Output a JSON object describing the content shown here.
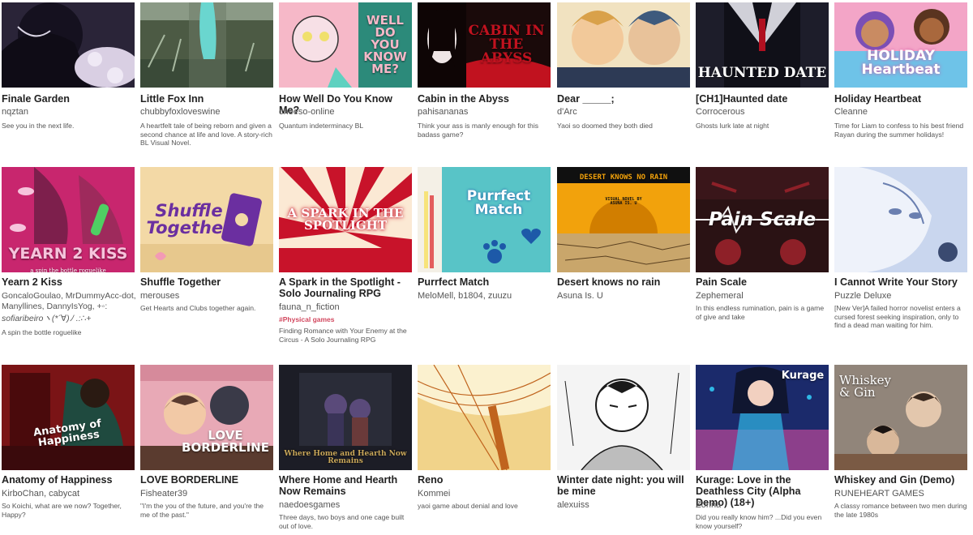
{
  "games": [
    {
      "title": "Finale Garden",
      "author": "nqztan",
      "desc": "See you in the next life.",
      "thumb_text": "",
      "colors": [
        "#1a1626",
        "#d9cfe3",
        "#3b3355"
      ]
    },
    {
      "title": "Little Fox Inn",
      "author": "chubbyfoxloveswine",
      "desc": "A heartfelt tale of being reborn and given a second chance at life and love. A story-rich BL Visual Novel.",
      "thumb_text": "",
      "colors": [
        "#5b6e4f",
        "#a7b8a0",
        "#6ad6cf"
      ]
    },
    {
      "title": "How Well Do You Know Me?",
      "author": "cheeso-online",
      "desc": "Quantum indeterminacy BL",
      "thumb_text": "WELL DO YOU KNOW ME?",
      "colors": [
        "#f6b8c8",
        "#2c8a7a",
        "#f0e06c"
      ]
    },
    {
      "title": "Cabin in the Abyss",
      "author": "pahisananas",
      "desc": "Think your ass is manly enough for this badass game?",
      "thumb_text": "CABIN IN THE ABYSS",
      "colors": [
        "#1a0a0a",
        "#c1121f",
        "#efe6e6"
      ]
    },
    {
      "title": "Dear _____;",
      "author": "d'Arc",
      "desc": "Yaoi so doomed they both died",
      "thumb_text": "",
      "colors": [
        "#d9a14a",
        "#3e5a7d",
        "#f1e2c0"
      ]
    },
    {
      "title": "[CH1]Haunted date",
      "author": "Corrocerous",
      "desc": "Ghosts lurk late at night",
      "thumb_text": "HAUNTED DATE",
      "colors": [
        "#101018",
        "#d0d0d8",
        "#b01020"
      ]
    },
    {
      "title": "Holiday Heartbeat",
      "author": "Cleanne",
      "desc": "Time for Liam to confess to his best friend Rayan during the summer holidays!",
      "thumb_text": "HOLIDAY Heartbeat",
      "colors": [
        "#f3a5c7",
        "#6ec3e8",
        "#7b4fb5"
      ]
    },
    {
      "title": "Yearn 2 Kiss",
      "author": "GoncaloGoulao, MrDummyAcc-dot, Manyllines, DannyIsYog, +◦:",
      "author2": "sofiaribeiroヽ(*´∀)ﾉ .:∴+",
      "desc": "A spin the bottle roguelike",
      "thumb_text": "YEARN 2 KISS",
      "sub_text": "a spin the bottle roguelike",
      "colors": [
        "#c8266e",
        "#7d1f4c",
        "#f6c4dc"
      ]
    },
    {
      "title": "Shuffle Together",
      "author": "merouses",
      "desc": "Get Hearts and Clubs together again.",
      "thumb_text": "Shuffle Together",
      "colors": [
        "#f3d9a6",
        "#6b2fa0",
        "#f39ab5"
      ]
    },
    {
      "title": "A Spark in the Spotlight - Solo Journaling RPG",
      "author": "fauna_n_fiction",
      "tag": "#Physical games",
      "desc": "Finding Romance with Your Enemy at the Circus - A Solo Journaling RPG",
      "thumb_text": "A SPARK IN THE SPOTLIGHT",
      "colors": [
        "#c8132a",
        "#fbe9d4",
        "#ffffff"
      ]
    },
    {
      "title": "Purrfect Match",
      "author": "MeloMell, b1804, zuuzu",
      "desc": "",
      "thumb_text": "Purrfect Match",
      "colors": [
        "#58c4c7",
        "#1d59a8",
        "#f7e37a"
      ]
    },
    {
      "title": "Desert knows no rain",
      "author": "Asuna Is. U",
      "desc": "",
      "thumb_text": "DESERT KNOWS NO RAIN",
      "sub_text": "VISUAL NOVEL BY ASUNA IS. U",
      "colors": [
        "#101010",
        "#f2a20c",
        "#c9a66b"
      ]
    },
    {
      "title": "Pain Scale",
      "author": "Zephemeral",
      "desc": "In this endless rumination, pain is a game of give and take",
      "thumb_text": "Pain Scale",
      "colors": [
        "#2a1214",
        "#8e2028",
        "#f2f2f2"
      ]
    },
    {
      "title": "I Cannot Write Your Story",
      "author": "Puzzle Deluxe",
      "desc": "[New Ver]A failed horror novelist enters a cursed forest seeking inspiration, only to find a dead man waiting for him.",
      "thumb_text": "",
      "colors": [
        "#c9d6ee",
        "#6a7fb0",
        "#eef2fa"
      ]
    },
    {
      "title": "Anatomy of Happiness",
      "author": "KirboChan, cabycat",
      "desc": "So Koichi, what are we now? Together, Happy?",
      "thumb_text": "Anatomy of Happiness",
      "colors": [
        "#7a1416",
        "#1f4a3f",
        "#e36b2a"
      ]
    },
    {
      "title": "LOVE BORDERLINE",
      "author": "Fisheater39",
      "desc": "\"I'm the you of the future, and you're the me of the past.\"",
      "thumb_text": "LOVE BORDERLINE",
      "colors": [
        "#e8a9b6",
        "#5a3b2f",
        "#ffffff"
      ]
    },
    {
      "title": "Where Home and Hearth Now Remains",
      "author": "naedoesgames",
      "desc": "Three days, two boys and one cage built out of love.",
      "thumb_text": "Where Home and Hearth Now Remains",
      "colors": [
        "#1c1d26",
        "#c9a75a",
        "#5a4a7a"
      ]
    },
    {
      "title": "Reno",
      "author": "Kommei",
      "desc": "yaoi game about denial and love",
      "thumb_text": "",
      "colors": [
        "#f1d38a",
        "#c0641e",
        "#fbf1cf"
      ]
    },
    {
      "title": "Winter date night: you will be mine",
      "author": "alexuiss",
      "desc": "",
      "thumb_text": "",
      "colors": [
        "#f4f4f4",
        "#1a1a1a",
        "#bdbdbd"
      ]
    },
    {
      "title": "Kurage: Love in the Deathless City (Alpha Demo) (18+)",
      "author": "Zorina",
      "desc": "Did you really know him? ...Did you even know yourself?",
      "thumb_text": "Kurage",
      "colors": [
        "#1b2a6b",
        "#d84fa0",
        "#2fb8e6"
      ]
    },
    {
      "title": "Whiskey and Gin (Demo)",
      "author": "RUNEHEART GAMES",
      "desc": "A classy romance between two men during the late 1980s",
      "thumb_text": "Whiskey & Gin",
      "colors": [
        "#2a2625",
        "#c8b9a8",
        "#7a5a44"
      ]
    }
  ]
}
